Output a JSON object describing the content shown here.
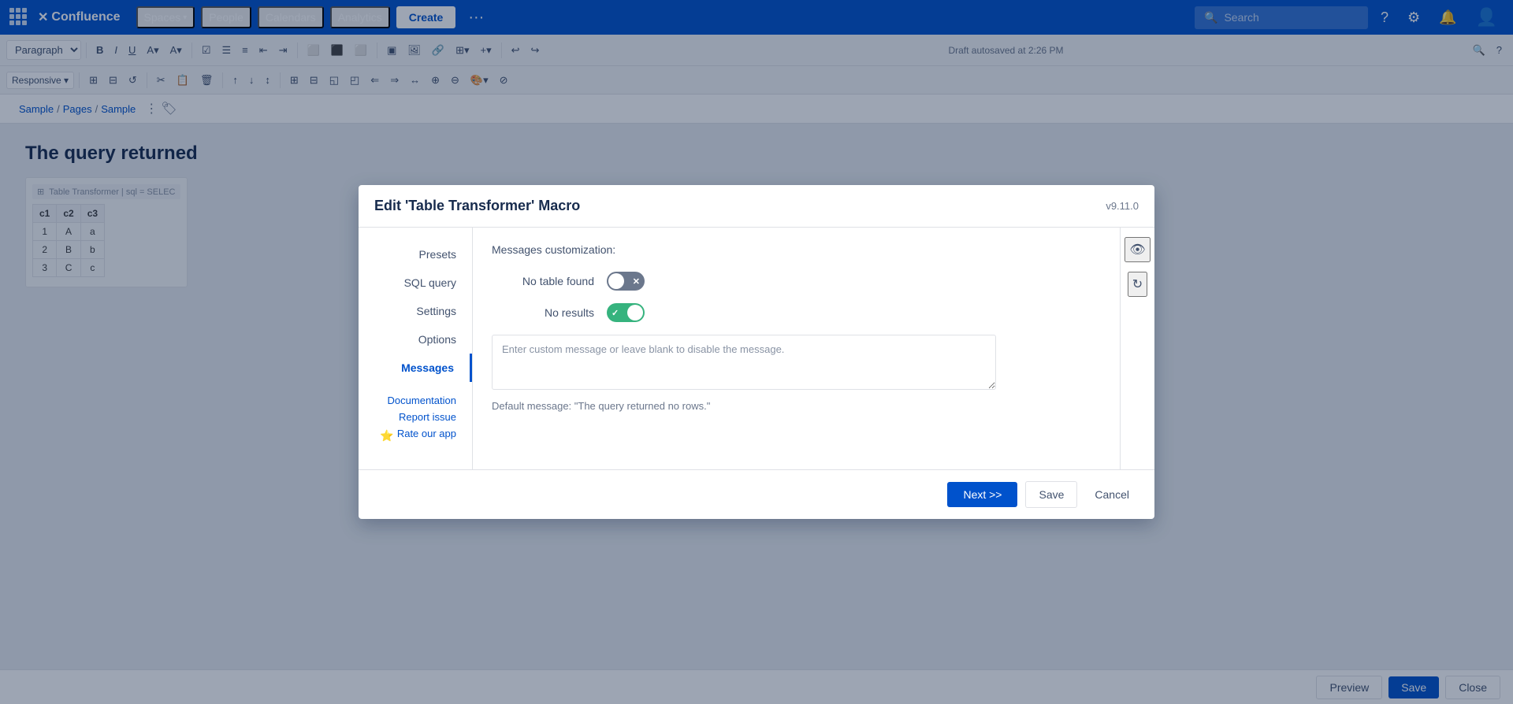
{
  "nav": {
    "brand": "Confluence",
    "brand_x": "✕",
    "spaces_label": "Spaces",
    "people_label": "People",
    "calendars_label": "Calendars",
    "analytics_label": "Analytics",
    "create_label": "Create",
    "more_label": "···",
    "search_placeholder": "Search",
    "draft_status": "Draft autosaved at 2:26 PM"
  },
  "toolbar": {
    "paragraph_label": "Paragraph",
    "bold_label": "B",
    "italic_label": "I",
    "underline_label": "U"
  },
  "breadcrumb": {
    "sample1": "Sample",
    "sep1": "/",
    "pages": "Pages",
    "sep2": "/",
    "sample2": "Sample"
  },
  "page": {
    "title": "The query returned"
  },
  "tt_preview": {
    "header": "Table Transformer | sql = SELEC",
    "columns": [
      "c1",
      "c2",
      "c3"
    ],
    "rows": [
      [
        "1",
        "A",
        "a"
      ],
      [
        "2",
        "B",
        "b"
      ],
      [
        "3",
        "C",
        "c"
      ]
    ]
  },
  "bottom_bar": {
    "preview_label": "Preview",
    "save_label": "Save",
    "close_label": "Close"
  },
  "modal": {
    "title": "Edit 'Table Transformer' Macro",
    "version": "v9.11.0",
    "sidebar_items": [
      {
        "label": "Presets",
        "active": false
      },
      {
        "label": "SQL query",
        "active": false
      },
      {
        "label": "Settings",
        "active": false
      },
      {
        "label": "Options",
        "active": false
      },
      {
        "label": "Messages",
        "active": true
      }
    ],
    "sidebar_links": {
      "documentation": "Documentation",
      "report_issue": "Report issue",
      "rate_app": "Rate our app",
      "star": "⭐"
    },
    "section_title": "Messages customization:",
    "no_table_found_label": "No table found",
    "no_results_label": "No results",
    "no_table_toggle_state": "off",
    "no_results_toggle_state": "on",
    "textarea_placeholder": "Enter custom message or leave blank to disable the message.",
    "default_message_label": "Default message:  \"The query returned no rows.\"",
    "right_icons": {
      "eye": "👁",
      "refresh": "↻"
    },
    "footer": {
      "next_label": "Next >>",
      "save_label": "Save",
      "cancel_label": "Cancel"
    }
  }
}
